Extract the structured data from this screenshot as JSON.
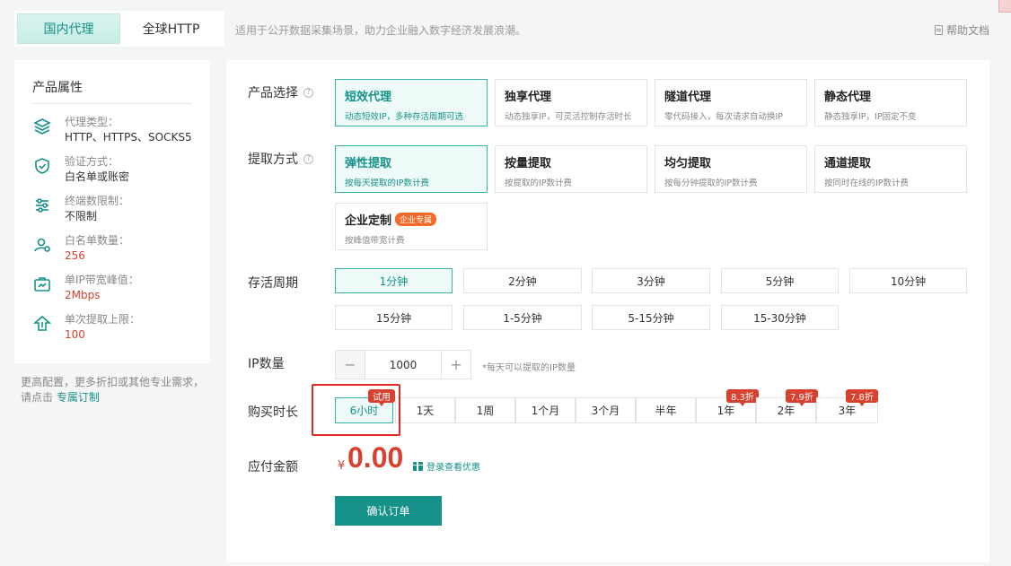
{
  "tabs": [
    {
      "label": "国内代理",
      "active": true
    },
    {
      "label": "全球HTTP",
      "active": false
    }
  ],
  "top_desc": "适用于公开数据采集场景，助力企业融入数字经济发展浪潮。",
  "help_label": "帮助文档",
  "sidebar": {
    "title": "产品属性",
    "items": [
      {
        "label": "代理类型：",
        "value": "HTTP、HTTPS、SOCKS5",
        "icon": "layers-icon"
      },
      {
        "label": "验证方式：",
        "value": "白名单或账密",
        "icon": "shield-icon"
      },
      {
        "label": "终端数限制：",
        "value": "不限制",
        "icon": "sliders-icon"
      },
      {
        "label": "白名单数量：",
        "value": "256",
        "icon": "user-icon"
      },
      {
        "label": "单IP带宽峰值：",
        "value": "2Mbps",
        "icon": "bandwidth-icon"
      },
      {
        "label": "单次提取上限：",
        "value": "100",
        "icon": "upload-icon"
      }
    ],
    "note_text": "更高配置，更多折扣或其他专业需求，请点击",
    "note_link": "专属订制"
  },
  "product": {
    "label": "产品选择",
    "options": [
      {
        "title": "短效代理",
        "sub": "动态短效IP，多种存活周期可选",
        "active": true
      },
      {
        "title": "独享代理",
        "sub": "动态独享IP，可灵活控制存活时长",
        "active": false
      },
      {
        "title": "隧道代理",
        "sub": "零代码接入，每次请求自动换IP",
        "active": false
      },
      {
        "title": "静态代理",
        "sub": "静态独享IP，IP固定不变",
        "active": false
      }
    ]
  },
  "extract": {
    "label": "提取方式",
    "options": [
      {
        "title": "弹性提取",
        "sub": "按每天提取的IP数计费",
        "active": true
      },
      {
        "title": "按量提取",
        "sub": "按提取的IP数计费",
        "active": false
      },
      {
        "title": "均匀提取",
        "sub": "按每分钟提取的IP数计费",
        "active": false
      },
      {
        "title": "通道提取",
        "sub": "按同时在线的IP数计费",
        "active": false
      },
      {
        "title": "企业定制",
        "tag": "企业专属",
        "sub": "按峰值带宽计费",
        "active": false
      }
    ]
  },
  "lifetime": {
    "label": "存活周期",
    "options": [
      "1分钟",
      "2分钟",
      "3分钟",
      "5分钟",
      "10分钟",
      "15分钟",
      "1-5分钟",
      "5-15分钟",
      "15-30分钟"
    ],
    "selected": 0
  },
  "ip_count": {
    "label": "IP数量",
    "minus": "−",
    "plus": "+",
    "value": "1000",
    "hint": "*每天可以提取的IP数量"
  },
  "duration": {
    "label": "购买时长",
    "options": [
      {
        "label": "6小时",
        "badge": "试用",
        "active": true
      },
      {
        "label": "1天"
      },
      {
        "label": "1周"
      },
      {
        "label": "1个月"
      },
      {
        "label": "3个月"
      },
      {
        "label": "半年"
      },
      {
        "label": "1年",
        "badge": "8.3折"
      },
      {
        "label": "2年",
        "badge": "7.9折"
      },
      {
        "label": "3年",
        "badge": "7.8折"
      }
    ]
  },
  "price": {
    "label": "应付金额",
    "currency": "¥",
    "amount": "0.00",
    "promo": "登录查看优惠"
  },
  "confirm_label": "确认订单",
  "colors": {
    "accent": "#16928a",
    "price": "#d9412f",
    "badge": "#d9412f",
    "highlight": "#e0291f"
  }
}
